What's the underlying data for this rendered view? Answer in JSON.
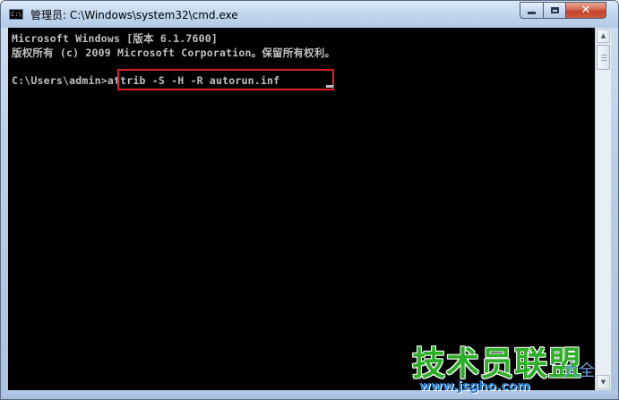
{
  "window": {
    "title": "管理员: C:\\Windows\\system32\\cmd.exe",
    "title_icon_text": "C:\\",
    "close_glyph": "✕"
  },
  "console": {
    "lines": [
      "Microsoft Windows [版本 6.1.7600]",
      "版权所有 (c) 2009 Microsoft Corporation。保留所有权利。"
    ],
    "prompt": "C:\\Users\\admin>",
    "command": "attrib -S -H -R autorun.inf",
    "text_color": "#c0c0c0",
    "background_color": "#000000",
    "highlight_color": "#e02020"
  },
  "watermark": {
    "title": "技术员联盟",
    "suffix": "大全",
    "url": "www.jsgho.com"
  },
  "icons": {
    "title_icon": "cmd-icon",
    "minimize": "minimize-icon",
    "maximize": "maximize-icon",
    "close": "close-icon",
    "scroll_up": "scroll-up-arrow-icon",
    "scroll_down": "scroll-down-arrow-icon"
  }
}
